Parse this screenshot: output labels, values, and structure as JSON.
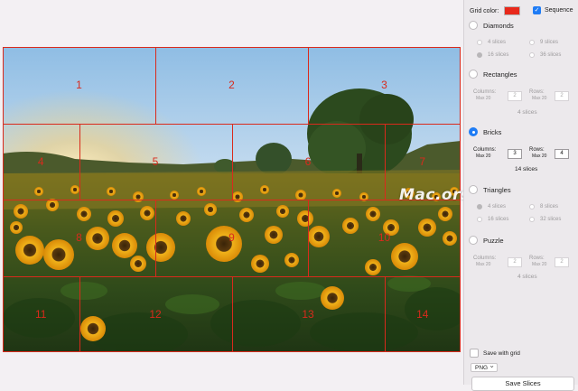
{
  "canvas": {
    "watermark": "Mac.orsoon.com",
    "grid_color": "#d92a1c",
    "slice_numbers": [
      "1",
      "2",
      "3",
      "4",
      "5",
      "6",
      "7",
      "8",
      "9",
      "10",
      "11",
      "12",
      "13",
      "14"
    ]
  },
  "panel": {
    "grid_color_label": "Grid color:",
    "grid_color_value": "#e8281b",
    "sequence_label": "Sequence",
    "sequence_checked": true,
    "modes": {
      "diamonds": {
        "label": "Diamonds",
        "options": [
          "4 slices",
          "9 slices",
          "16 slices",
          "36 slices"
        ],
        "selected_option": "16 slices"
      },
      "rectangles": {
        "label": "Rectangles",
        "columns_label": "Columns:",
        "columns_max": "Max 20",
        "columns_value": "2",
        "rows_label": "Rows:",
        "rows_max": "Max 20",
        "rows_value": "2",
        "slices": "4 slices"
      },
      "bricks": {
        "label": "Bricks",
        "selected": true,
        "columns_label": "Columns:",
        "columns_max": "Max 20",
        "columns_value": "3",
        "rows_label": "Rows:",
        "rows_max": "Max 20",
        "rows_value": "4",
        "slices": "14 slices"
      },
      "triangles": {
        "label": "Triangles",
        "options": [
          "4 slices",
          "8 slices",
          "16 slices",
          "32 slices"
        ],
        "selected_option": "4 slices"
      },
      "puzzle": {
        "label": "Puzzle",
        "columns_label": "Columns:",
        "columns_max": "Max 20",
        "columns_value": "2",
        "rows_label": "Rows:",
        "rows_max": "Max 20",
        "rows_value": "2",
        "slices": "4 slices"
      }
    },
    "save_with_grid_label": "Save with grid",
    "format_value": "PNG",
    "save_button": "Save Slices"
  }
}
